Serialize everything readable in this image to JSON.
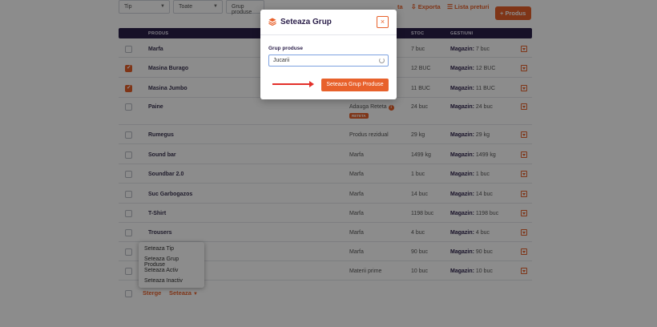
{
  "toolbar": {
    "tip_select": "Tip",
    "toate_select": "Toate",
    "grup_select": "Grup produse",
    "partial_link": "ta",
    "export_label": "Exporta",
    "lista_label": "Lista preturi",
    "produs_label": "Produs"
  },
  "table": {
    "headers": {
      "produs": "PRODUS",
      "stoc": "STOC",
      "gestiuni": "GESTIUNI"
    },
    "gest_prefix": "Magazin:",
    "rows": [
      {
        "name": "Marfa",
        "tip": "",
        "stoc": "7 buc",
        "gest": "7 buc",
        "checked": false
      },
      {
        "name": "Masina Burago",
        "tip": "",
        "stoc": "12 BUC",
        "gest": "12 BUC",
        "checked": true
      },
      {
        "name": "Masina Jumbo",
        "tip": "",
        "stoc": "11 BUC",
        "gest": "11 BUC",
        "checked": true
      },
      {
        "name": "Paine",
        "tip": "Adauga Reteta",
        "stoc": "24 buc",
        "gest": "24 buc",
        "checked": false,
        "badge": "RETETA"
      },
      {
        "name": "Rumegus",
        "tip": "Produs rezidual",
        "stoc": "29 kg",
        "gest": "29 kg",
        "checked": false
      },
      {
        "name": "Sound bar",
        "tip": "Marfa",
        "stoc": "1499 kg",
        "gest": "1499 kg",
        "checked": false
      },
      {
        "name": "Soundbar 2.0",
        "tip": "Marfa",
        "stoc": "1 buc",
        "gest": "1 buc",
        "checked": false
      },
      {
        "name": "Suc Garbogazos",
        "tip": "Marfa",
        "stoc": "14 buc",
        "gest": "14 buc",
        "checked": false
      },
      {
        "name": "T-Shirt",
        "tip": "Marfa",
        "stoc": "1198 buc",
        "gest": "1198 buc",
        "checked": false
      },
      {
        "name": "Trousers",
        "tip": "Marfa",
        "stoc": "4 buc",
        "gest": "4 buc",
        "checked": false
      },
      {
        "name": "",
        "tip": "Marfa",
        "stoc": "90 buc",
        "gest": "90 buc",
        "checked": false
      },
      {
        "name": "",
        "tip": "Materii prime",
        "stoc": "10 buc",
        "gest": "10 buc",
        "checked": false
      }
    ]
  },
  "bottom": {
    "sterge": "Sterge",
    "seteaza": "Seteaza"
  },
  "dropdown": [
    "Seteaza Tip",
    "Seteaza Grup Produse",
    "Seteaza Activ",
    "Seteaza Inactiv"
  ],
  "modal": {
    "title": "Seteaza Grup",
    "field_label": "Grup produse",
    "field_value": "Jucarii",
    "submit_label": "Seteaza Grup Produse",
    "close_symbol": "×"
  },
  "colors": {
    "accent": "#e8612b",
    "header_bg": "#2b1f4a",
    "arrow": "#e3302a"
  },
  "icons": [
    "layers-icon",
    "close-icon",
    "spinner-icon",
    "plus-icon",
    "export-icon",
    "list-icon",
    "chevron-down-icon",
    "info-icon",
    "action-dropdown-icon"
  ]
}
